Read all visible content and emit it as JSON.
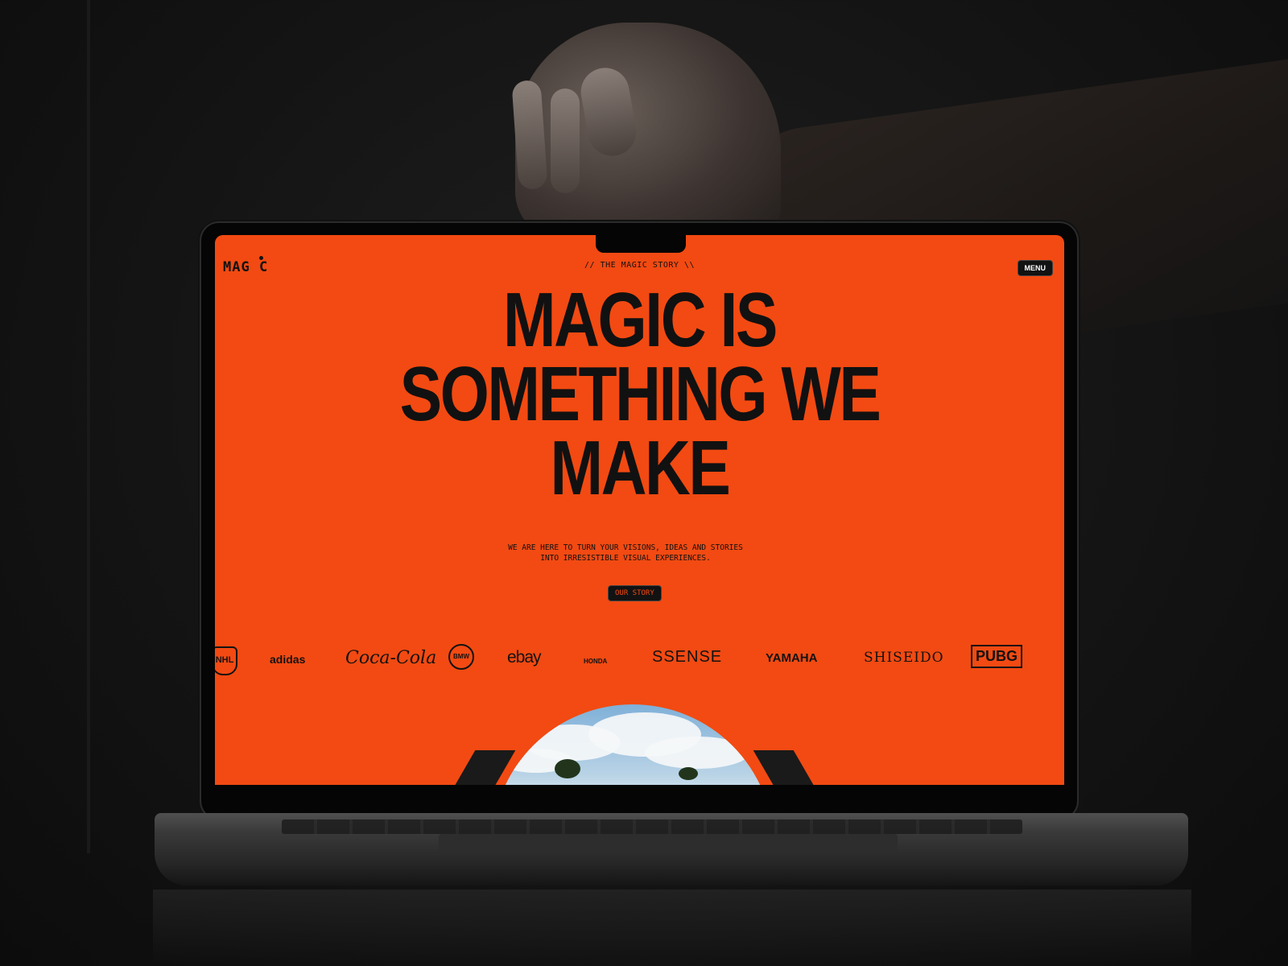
{
  "header": {
    "logo": "MAG C",
    "breadcrumb": "// THE MAGIC STORY \\\\",
    "menu_label": "MENU"
  },
  "hero": {
    "headline": [
      "MAGIC IS",
      "SOMETHING WE",
      "MAKE"
    ],
    "subtext": "WE ARE HERE TO TURN YOUR VISIONS, IDEAS AND STORIES INTO IRRESISTIBLE VISUAL EXPERIENCES.",
    "cta_label": "OUR STORY"
  },
  "clients": {
    "logos": [
      "NHL",
      "adidas",
      "Coca-Cola",
      "BMW",
      "ebay",
      "HONDA",
      "SSENSE",
      "YAMAHA",
      "SHISEIDO",
      "PUBG"
    ]
  },
  "colors": {
    "brand_orange": "#f24a12",
    "ink": "#121212"
  }
}
